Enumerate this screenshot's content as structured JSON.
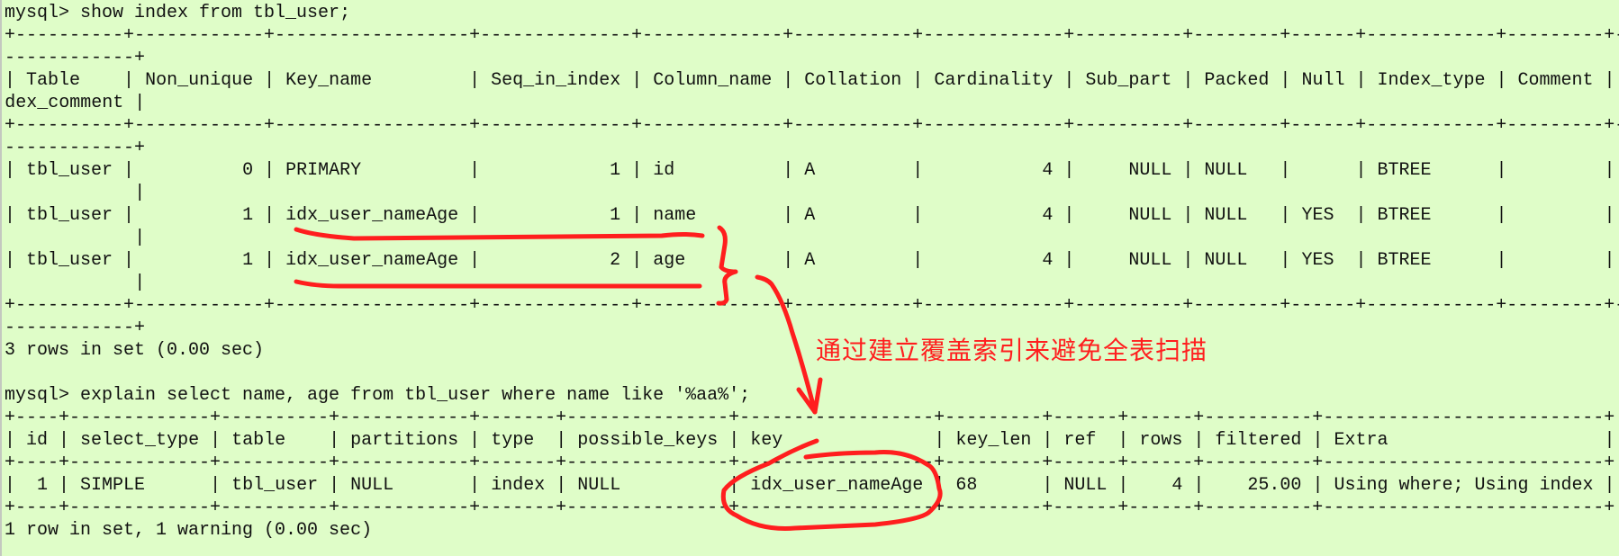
{
  "prompt": "mysql> ",
  "index_query": {
    "command": "show index from tbl_user;",
    "table": {
      "columns": [
        "Table",
        "Non_unique",
        "Key_name",
        "Seq_in_index",
        "Column_name",
        "Collation",
        "Cardinality",
        "Sub_part",
        "Packed",
        "Null",
        "Index_type",
        "Comment",
        "Index_comment"
      ],
      "rows": [
        [
          "tbl_user",
          "0",
          "PRIMARY",
          "1",
          "id",
          "A",
          "4",
          "NULL",
          "NULL",
          "",
          "BTREE",
          "",
          ""
        ],
        [
          "tbl_user",
          "1",
          "idx_user_nameAge",
          "1",
          "name",
          "A",
          "4",
          "NULL",
          "NULL",
          "YES",
          "BTREE",
          "",
          ""
        ],
        [
          "tbl_user",
          "1",
          "idx_user_nameAge",
          "2",
          "age",
          "A",
          "4",
          "NULL",
          "NULL",
          "YES",
          "BTREE",
          "",
          ""
        ]
      ]
    },
    "footer": "3 rows in set (0.00 sec)"
  },
  "explain_query": {
    "command": "explain select name, age from tbl_user where name like '%aa%';",
    "table": {
      "columns": [
        "id",
        "select_type",
        "table",
        "partitions",
        "type",
        "possible_keys",
        "key",
        "key_len",
        "ref",
        "rows",
        "filtered",
        "Extra"
      ],
      "rows": [
        [
          "1",
          "SIMPLE",
          "tbl_user",
          "NULL",
          "index",
          "NULL",
          "idx_user_nameAge",
          "68",
          "NULL",
          "4",
          "25.00",
          "Using where; Using index"
        ]
      ]
    },
    "footer": "1 row in set, 1 warning (0.00 sec)"
  },
  "annotation": {
    "text": "通过建立覆盖索引来避免全表扫描",
    "color": "#ff1e1e"
  }
}
